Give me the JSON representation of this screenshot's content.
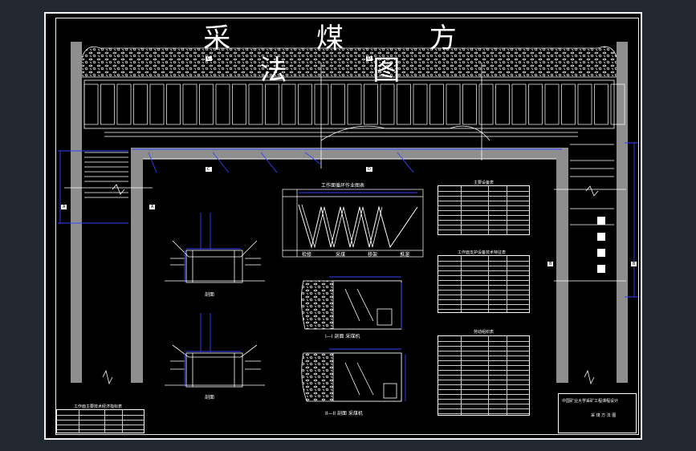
{
  "drawing": {
    "title": "采 煤 方 法 图",
    "section_marks": [
      "C",
      "D",
      "C",
      "D"
    ],
    "end_marks": [
      "A",
      "A",
      "B",
      "B"
    ],
    "section_labels": [
      "I—I 剖面",
      "II—II 剖面"
    ],
    "section_caption_left": "剖面",
    "section_caption_right_top": "I—I 剖面  采煤机",
    "section_caption_right_bottom": "II—II 剖面  采煤机",
    "cycle_chart_title": "工作面循环作业图表",
    "cycle_row_labels": [
      "检修",
      "采煤",
      "移架",
      "推溜"
    ],
    "tables": {
      "main_equipment": "主要设备表",
      "roof_support": "工作面支护设备技术特征表",
      "crew": "劳动组织表",
      "bottom_left": "工作面主要技术经济指标表"
    },
    "title_block": {
      "main": "中国矿业大学采矿工程课程设计",
      "sub": "采 煤 方 法 图"
    }
  },
  "colors": {
    "background": "#212830",
    "paper": "#000000",
    "lines": "#ffffff",
    "dimension": "#3333ff",
    "roadway": "#9a9a9a"
  }
}
